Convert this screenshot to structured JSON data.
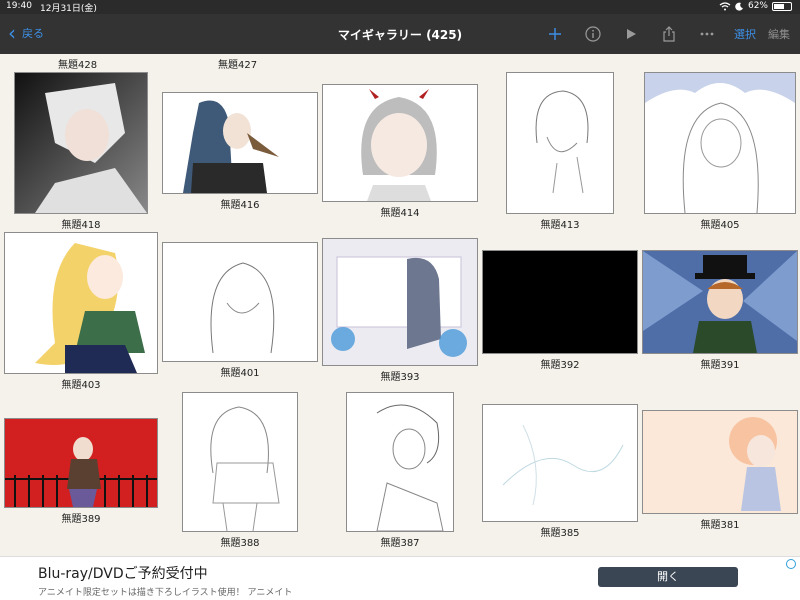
{
  "status": {
    "time": "19:40",
    "date": "12月31日(金)",
    "battery": "62%",
    "battery_level": 0.62
  },
  "nav": {
    "back_label": "戻る",
    "title": "マイギャラリー (425)",
    "select_label": "選択",
    "edit_label": "編集",
    "icons": [
      "plus-icon",
      "info-icon",
      "play-icon",
      "share-icon",
      "more-icon"
    ]
  },
  "gallery": {
    "top_labels": [
      "無題428",
      "無題427"
    ],
    "items": [
      "無題418",
      "無題416",
      "無題414",
      "無題413",
      "無題405",
      "無題403",
      "無題401",
      "無題393",
      "無題392",
      "無題391",
      "無題389",
      "無題388",
      "無題387",
      "無題385",
      "無題381"
    ]
  },
  "ad": {
    "headline": "Blu-ray/DVDご予約受付中",
    "subtext": "アニメイト限定セットは描き下ろしイラスト使用！ アニメイト",
    "button_label": "開く"
  }
}
